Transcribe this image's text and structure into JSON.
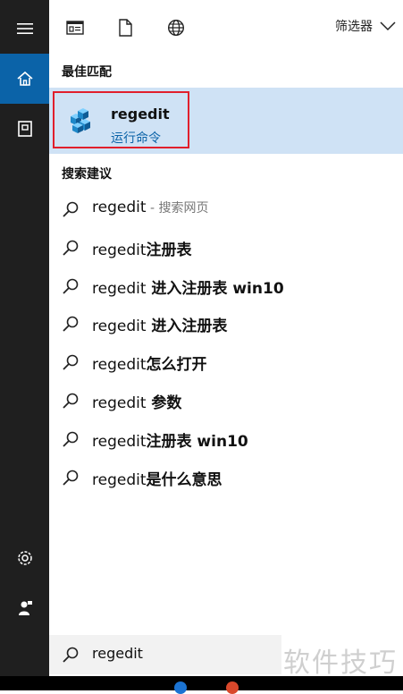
{
  "toolbar": {
    "icons": [
      "document-view-icon",
      "file-icon",
      "globe-icon"
    ],
    "filter_label": "筛选器"
  },
  "best_match": {
    "section_title": "最佳匹配",
    "title": "regedit",
    "subtitle": "运行命令"
  },
  "suggestions": {
    "section_title": "搜索建议",
    "items": [
      {
        "prefix": "regedit",
        "suffix": "",
        "hint": " - 搜索网页"
      },
      {
        "prefix": "regedit",
        "suffix": "注册表",
        "hint": ""
      },
      {
        "prefix": "regedit",
        "suffix": " 进入注册表 win10",
        "hint": ""
      },
      {
        "prefix": "regedit",
        "suffix": " 进入注册表",
        "hint": ""
      },
      {
        "prefix": "regedit",
        "suffix": "怎么打开",
        "hint": ""
      },
      {
        "prefix": "regedit",
        "suffix": " 参数",
        "hint": ""
      },
      {
        "prefix": "regedit",
        "suffix": "注册表 win10",
        "hint": ""
      },
      {
        "prefix": "regedit",
        "suffix": "是什么意思",
        "hint": ""
      }
    ]
  },
  "search": {
    "value": "regedit"
  },
  "watermark": "软件技巧",
  "colors": {
    "rail": "#1f1f1f",
    "accent": "#0b63a8",
    "selection": "#cfe2f5",
    "highlight_border": "#e11f2c"
  }
}
